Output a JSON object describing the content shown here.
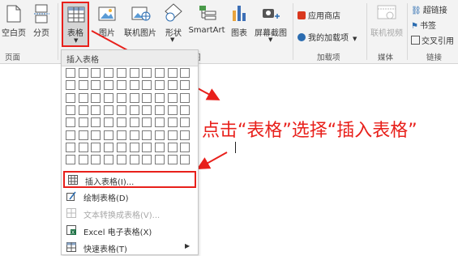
{
  "ribbon": {
    "pages_group": {
      "blank_page": "空白页",
      "page_break": "分页",
      "group_label": "页面"
    },
    "table_button": "表格",
    "picture": "图片",
    "online_picture": "联机图片",
    "shapes": "形状",
    "smartart": "SmartArt",
    "chart": "图表",
    "screenshot": "屏幕截图",
    "illustrations_group_label": "图",
    "store": "应用商店",
    "my_addins": "我的加载项",
    "addins_group_label": "加载项",
    "online_video": "联机视频",
    "media_group_label": "媒体",
    "hyperlink": "超链接",
    "bookmark": "书签",
    "cross_reference": "交叉引用",
    "links_group_label": "链接"
  },
  "dropdown": {
    "title": "插入表格",
    "items": [
      {
        "label": "插入表格(I)...",
        "icon": "insert-table-icon",
        "enabled": true,
        "highlighted": true
      },
      {
        "label": "绘制表格(D)",
        "icon": "draw-table-icon",
        "enabled": true
      },
      {
        "label": "文本转换成表格(V)...",
        "icon": "text-to-table-icon",
        "enabled": false
      },
      {
        "label": "Excel 电子表格(X)",
        "icon": "excel-icon",
        "enabled": true
      },
      {
        "label": "快速表格(T)",
        "icon": "quick-tables-icon",
        "enabled": true,
        "submenu": true
      }
    ]
  },
  "annotation": {
    "text": "点击“表格”选择“插入表格”",
    "color": "#e8201b"
  },
  "colors": {
    "highlight_box": "#e8201b",
    "ribbon_bg": "#f3f3f3"
  }
}
